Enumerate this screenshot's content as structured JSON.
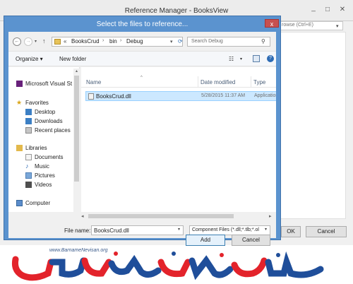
{
  "outer_window": {
    "title": "Reference Manager - BooksView",
    "search_placeholder": "rowse (Ctrl+E)",
    "ok_label": "OK",
    "cancel_label": "Cancel"
  },
  "dialog": {
    "title": "Select the files to reference...",
    "close_label": "x",
    "address": {
      "chevron": "«",
      "crumbs": [
        "BooksCrud",
        "bin",
        "Debug"
      ],
      "separator": "›"
    },
    "search_placeholder": "Search Debug",
    "toolbar": {
      "organize_label": "Organize ▾",
      "new_folder_label": "New folder"
    },
    "nav": {
      "vs": "Microsoft Visual St",
      "favorites": "Favorites",
      "desktop": "Desktop",
      "downloads": "Downloads",
      "recent": "Recent places",
      "libraries": "Libraries",
      "documents": "Documents",
      "music": "Music",
      "pictures": "Pictures",
      "videos": "Videos",
      "computer": "Computer"
    },
    "columns": {
      "name": "Name",
      "date": "Date modified",
      "type": "Type"
    },
    "files": [
      {
        "name": "BooksCrud.dll",
        "date": "5/28/2015 11:37 AM",
        "type": "Application e"
      }
    ],
    "file_name_label": "File name:",
    "file_name_value": "BooksCrud.dll",
    "file_type_value": "Component Files (*.dll;*.tlb;*.ol",
    "add_label": "Add",
    "cancel_label": "Cancel"
  },
  "logo": {
    "url": "www.BarnameNevisan.org"
  },
  "colors": {
    "dialog_frame": "#5b93cf",
    "selection": "#cce8ff",
    "logo_red": "#e3232b",
    "logo_blue": "#1f4e9a"
  }
}
